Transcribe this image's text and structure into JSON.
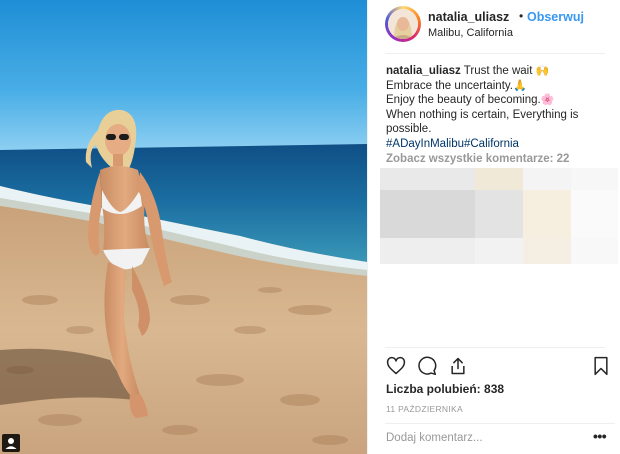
{
  "post": {
    "username": "natalia_uliasz",
    "separator": "•",
    "follow_label": "Obserwuj",
    "location": "Malibu, California"
  },
  "caption": {
    "username": "natalia_uliasz",
    "line1": "Trust the wait",
    "line1_emoji": "🙌",
    "line2": "Embrace the uncertainty.",
    "line2_emoji": "🙏",
    "line3": "Enjoy the beauty of becoming.",
    "line3_emoji": "🌸",
    "line4": "When nothing is certain, Everything is",
    "line5": "possible.",
    "hashtags": "#ADayInMalibu#California"
  },
  "comments": {
    "view_all": "Zobacz wszystkie komentarze: 22"
  },
  "actions": {
    "like_icon": "heart-icon",
    "comment_icon": "comment-icon",
    "share_icon": "share-icon",
    "save_icon": "bookmark-icon"
  },
  "likes": {
    "label": "Liczba polubień:",
    "count": "838"
  },
  "date": "11 PAŹDZIERNIKA",
  "comment_input": {
    "placeholder": "Dodaj komentarz..."
  },
  "more_label": "•••",
  "colors": {
    "link": "#3897f0",
    "muted": "#999999",
    "text": "#262626",
    "hashtag": "#003569"
  }
}
